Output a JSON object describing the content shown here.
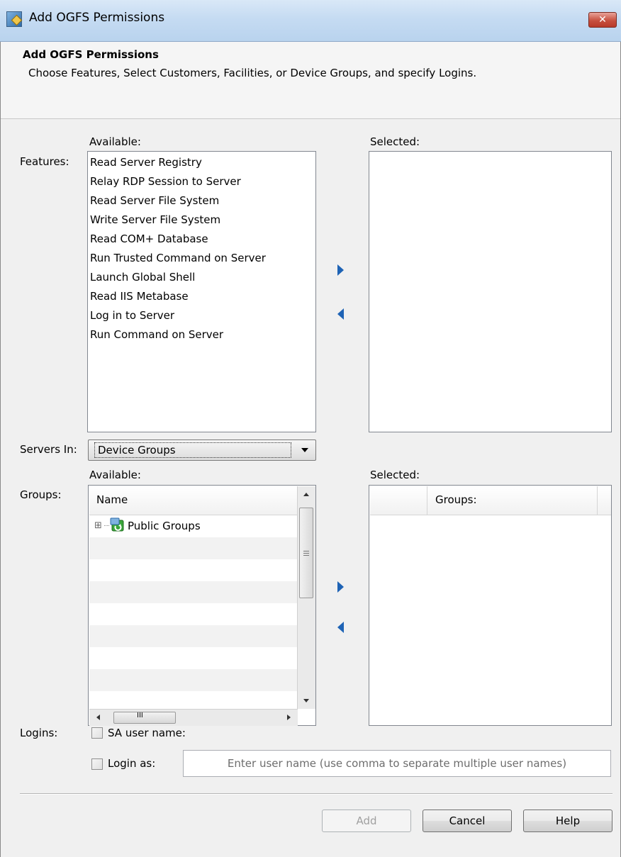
{
  "window": {
    "title": "Add OGFS Permissions",
    "close_glyph": "✕"
  },
  "header": {
    "title": "Add OGFS Permissions",
    "description": "Choose Features, Select Customers, Facilities, or Device Groups, and specify Logins."
  },
  "features": {
    "label": "Features:",
    "available_label": "Available:",
    "selected_label": "Selected:",
    "available_items": [
      "Read Server Registry",
      "Relay RDP Session to Server",
      "Read Server File System",
      "Write Server File System",
      "Read COM+ Database",
      "Run Trusted Command on Server",
      "Launch Global Shell",
      "Read IIS Metabase",
      "Log in to Server",
      "Run Command on Server"
    ],
    "selected_items": []
  },
  "servers_in": {
    "label": "Servers In:",
    "value": "Device Groups"
  },
  "groups": {
    "label": "Groups:",
    "available_label": "Available:",
    "selected_label": "Selected:",
    "tree_column": "Name",
    "tree_items": [
      {
        "label": "Public Groups",
        "expander": "⊞"
      }
    ],
    "selected_column": "Groups:",
    "scroll_h_grip": "III"
  },
  "logins": {
    "label": "Logins:",
    "sa_user_label": "SA user name:",
    "sa_user_checked": false,
    "login_as_label": "Login as:",
    "login_as_checked": false,
    "login_as_placeholder": "Enter user name (use comma to separate multiple user names)"
  },
  "buttons": {
    "add": "Add",
    "cancel": "Cancel",
    "help": "Help"
  },
  "icons": {
    "add_arrow": "arrow-right-icon",
    "remove_arrow": "arrow-left-icon",
    "group": "public-groups-icon"
  },
  "colors": {
    "arrow": "#1e63b5",
    "titlebar": "#c5dbf2",
    "close": "#c7503f"
  }
}
